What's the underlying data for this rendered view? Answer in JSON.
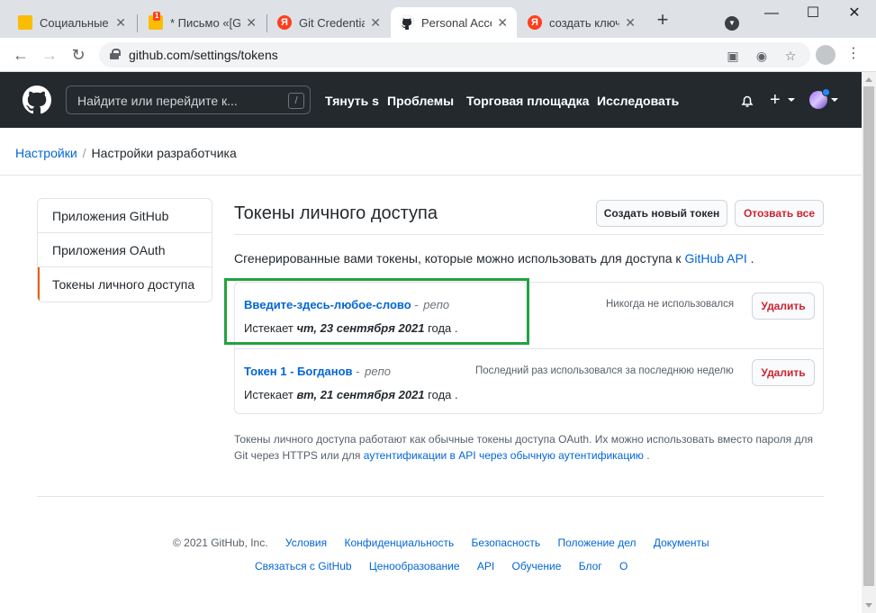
{
  "browser": {
    "tabs": [
      {
        "title": "Социальные с",
        "favicon": "gmail-icon"
      },
      {
        "title": "* Письмо «[Gi",
        "favicon": "yandex-mail-icon",
        "badge": "1"
      },
      {
        "title": "Git Credential",
        "favicon": "yandex-icon"
      },
      {
        "title": "Personal Acce",
        "favicon": "github-icon",
        "active": true
      },
      {
        "title": "создать ключ",
        "favicon": "yandex-icon"
      }
    ],
    "new_tab_label": "+",
    "address": "github.com/settings/tokens",
    "yandex_letter": "Я"
  },
  "github_header": {
    "search_placeholder": "Найдите или перейдите к...",
    "search_shortcut": "/",
    "nav": [
      "Тянуть s",
      "Проблемы",
      "Торговая площадка",
      "Исследовать"
    ]
  },
  "breadcrumb": {
    "root": "Настройки",
    "separator": "/",
    "current": "Настройки разработчика"
  },
  "sidebar": {
    "items": [
      {
        "label": "Приложения GitHub"
      },
      {
        "label": "Приложения OAuth"
      },
      {
        "label": "Токены личного доступа",
        "selected": true
      }
    ]
  },
  "main": {
    "title": "Токены личного доступа",
    "generate_button": "Создать новый токен",
    "revoke_all_button": "Отозвать все",
    "intro_text": "Сгенерированные вами токены, которые можно использовать для доступа к",
    "intro_link": "GitHub API",
    "intro_end": ".",
    "tokens": [
      {
        "name": "Введите-здесь-любое-слово",
        "scope": "репо",
        "last_used": "Никогда не использовался",
        "expires_prefix": "Истекает",
        "expires_date": "чт, 23 сентября 2021",
        "expires_suffix": "года .",
        "delete_label": "Удалить"
      },
      {
        "name": "Токен 1 - Богданов",
        "scope": "репо",
        "last_used": "Последний раз использовался за последнюю неделю",
        "expires_prefix": "Истекает",
        "expires_date": "вт, 21 сентября 2021",
        "expires_suffix": "года .",
        "delete_label": "Удалить"
      }
    ],
    "note_text": "Токены личного доступа работают как обычные токены доступа OAuth. Их можно использовать вместо пароля для Git через HTTPS или для",
    "note_link": "аутентификации в API через обычную аутентификацию",
    "note_end": "."
  },
  "footer": {
    "copyright": "© 2021 GitHub, Inc.",
    "row1": [
      "Условия",
      "Конфиденциальность",
      "Безопасность",
      "Положение дел",
      "Документы"
    ],
    "row2": [
      "Связаться с GitHub",
      "Ценообразование",
      "API",
      "Обучение",
      "Блог",
      "О"
    ]
  },
  "colors": {
    "header_bg": "#24292e",
    "link": "#0366d6",
    "danger": "#cb2431",
    "highlight_box": "#22a33f",
    "selected_marker": "#e36209"
  }
}
